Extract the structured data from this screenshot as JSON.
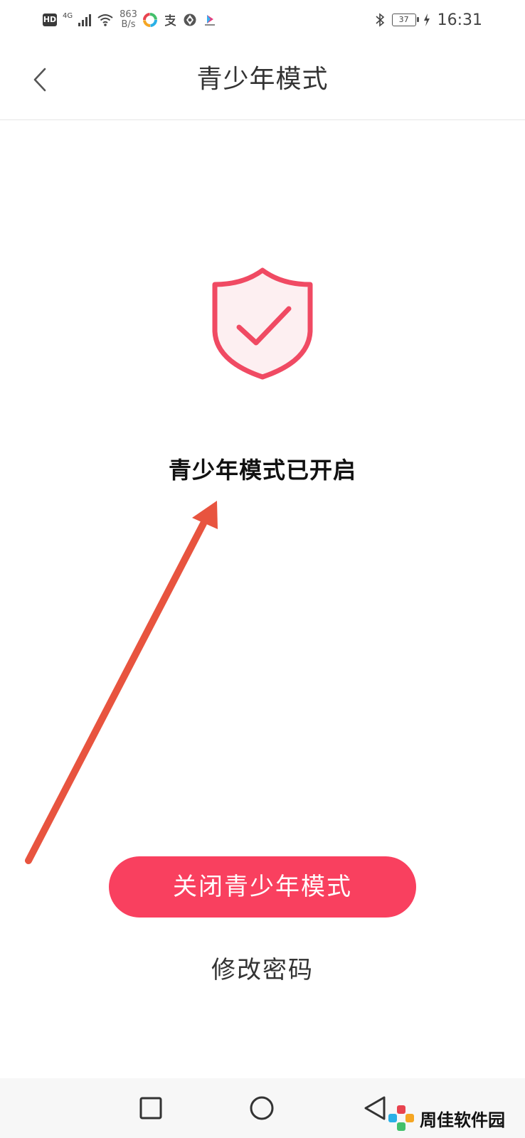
{
  "status_bar": {
    "hd": "HD",
    "network": "4G",
    "speed_value": "863",
    "speed_unit": "B/s",
    "battery": "37",
    "time": "16:31"
  },
  "header": {
    "title": "青少年模式",
    "back_icon": "chevron-left-icon"
  },
  "main": {
    "shield_icon": "shield-check-icon",
    "status_text": "青少年模式已开启",
    "close_button_label": "关闭青少年模式",
    "change_password_label": "修改密码"
  },
  "watermark": {
    "text": "周佳软件园"
  },
  "colors": {
    "accent": "#f9405f",
    "shield_stroke": "#f04a63",
    "shield_fill": "#fdeff1",
    "annotation_arrow": "#e8543f"
  }
}
